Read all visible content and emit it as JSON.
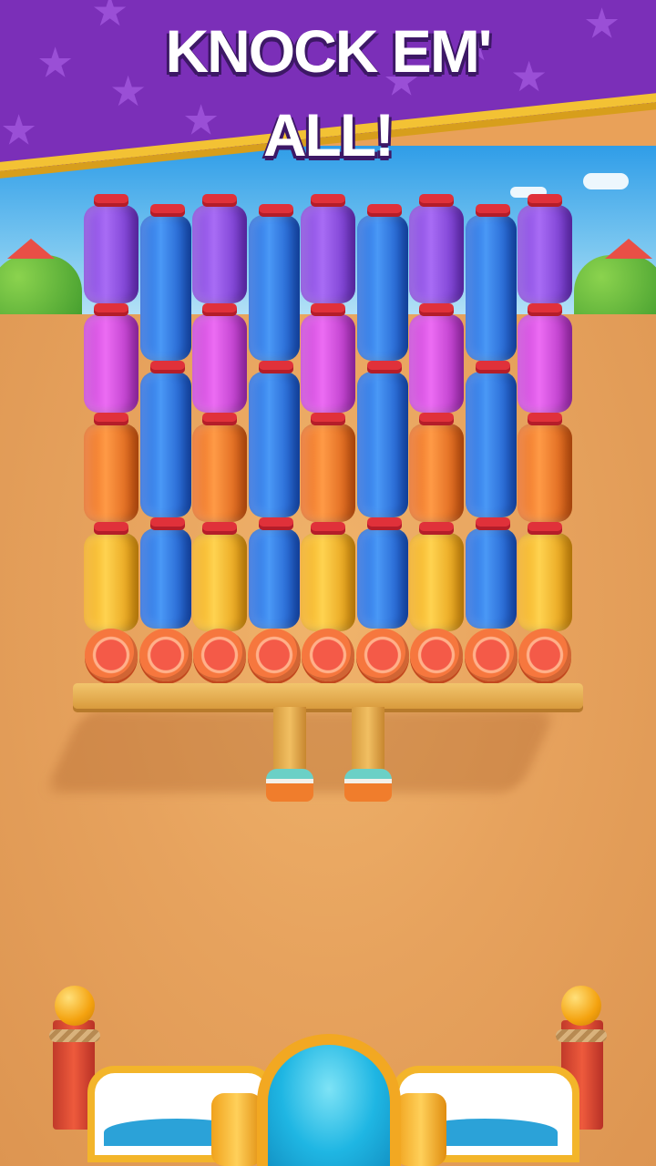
{
  "banner": {
    "line1": "KNOCK EM'",
    "line2": "ALL!"
  },
  "colors": {
    "banner_purple": "#7b2fb8",
    "banner_trim": "#f3c234",
    "sand": "#e9a159",
    "cannon_barrel": "#1fb6e3"
  },
  "tower": {
    "columns": 9,
    "row_colors_front": [
      "purple",
      "magenta",
      "orange",
      "yellow"
    ],
    "back_color": "blue",
    "bottom_row": "lying-caps"
  },
  "icons": {
    "banner_stars": "star-icon",
    "cannon": "cannon-icon"
  }
}
